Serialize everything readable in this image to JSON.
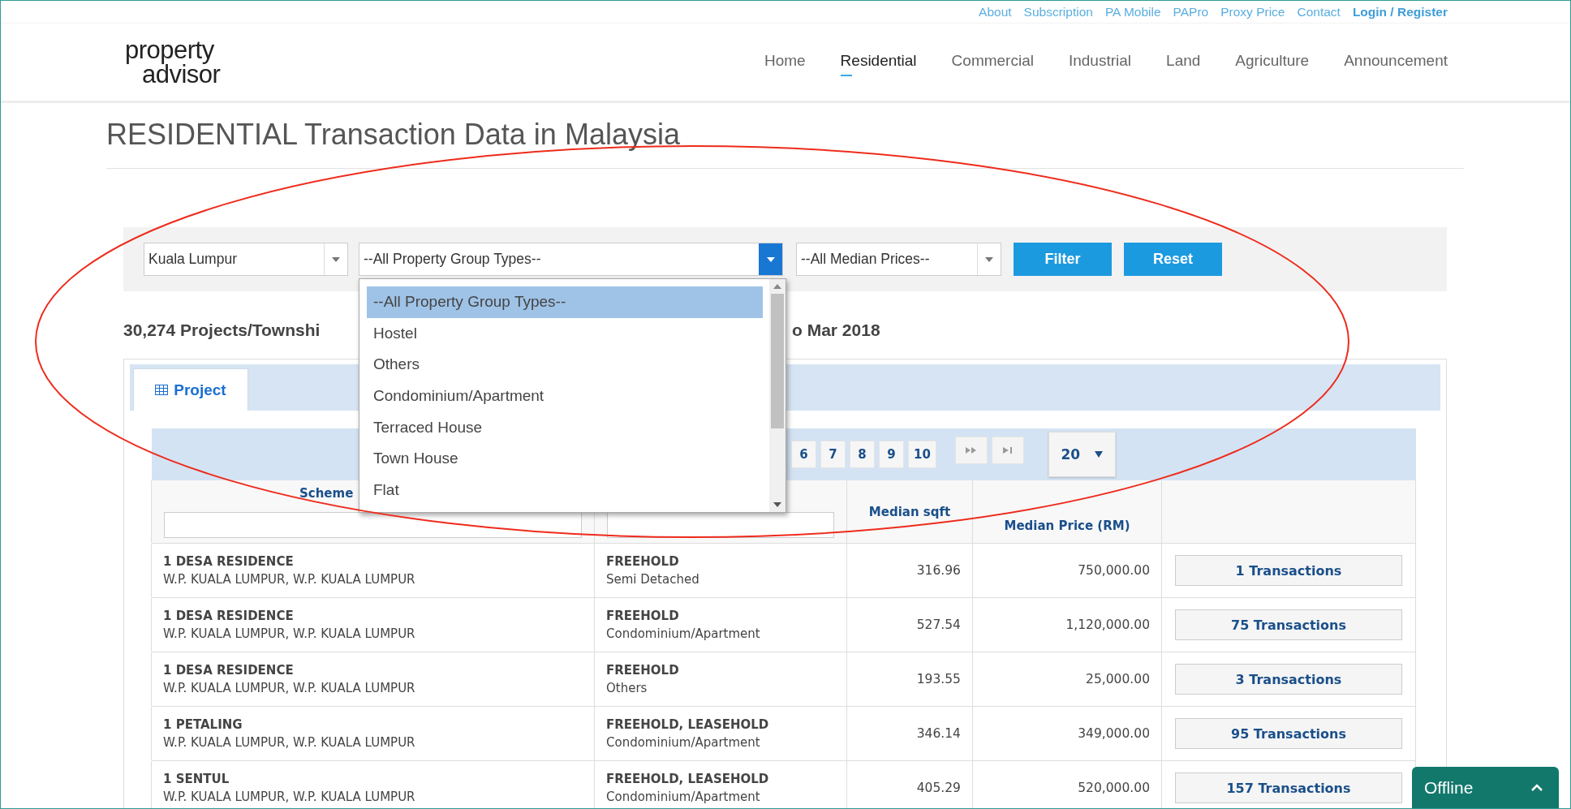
{
  "top_links": [
    {
      "label": "About",
      "kind": "link"
    },
    {
      "label": "Subscription",
      "kind": "link"
    },
    {
      "label": "PA Mobile",
      "kind": "link"
    },
    {
      "label": "PAPro",
      "kind": "link"
    },
    {
      "label": "Proxy Price",
      "kind": "link"
    },
    {
      "label": "Contact",
      "kind": "link"
    },
    {
      "label": "Login / Register",
      "kind": "account"
    }
  ],
  "logo": {
    "line1": "property",
    "line2": "advisor"
  },
  "nav": [
    {
      "label": "Home",
      "selected": false
    },
    {
      "label": "Residential",
      "selected": true
    },
    {
      "label": "Commercial",
      "selected": false
    },
    {
      "label": "Industrial",
      "selected": false
    },
    {
      "label": "Land",
      "selected": false
    },
    {
      "label": "Agriculture",
      "selected": false
    },
    {
      "label": "Announcement",
      "selected": false
    }
  ],
  "title": "RESIDENTIAL Transaction Data in Malaysia",
  "filters": {
    "state": "Kuala Lumpur",
    "group_type": {
      "value": "--All Property Group Types--",
      "open": true
    },
    "median_price": "--All Median Prices--"
  },
  "buttons": [
    "Filter",
    "Reset"
  ],
  "dropdown_options": [
    {
      "label": "--All Property Group Types--",
      "selected": true
    },
    {
      "label": "Hostel",
      "selected": false
    },
    {
      "label": "Others",
      "selected": false
    },
    {
      "label": "Condominium/Apartment",
      "selected": false
    },
    {
      "label": "Terraced House",
      "selected": false
    },
    {
      "label": "Town House",
      "selected": false
    },
    {
      "label": "Flat",
      "selected": false
    }
  ],
  "summary": [
    "30,274 Projects/Townshi",
    "o Mar 2018"
  ],
  "tabs": [
    {
      "label": "Project",
      "selected": true
    }
  ],
  "pager": {
    "pages": [
      "6",
      "7",
      "8",
      "9",
      "10"
    ],
    "page_size": "20"
  },
  "columns": [
    {
      "label": "Scheme",
      "filter": true
    },
    {
      "filter": true
    },
    {
      "label": "Median sqft"
    },
    {
      "label": "Median Price (RM)"
    }
  ],
  "rows": [
    {
      "name": "1 DESA RESIDENCE",
      "location": "W.P. KUALA LUMPUR, W.P. KUALA LUMPUR",
      "tenure": "FREEHOLD",
      "type": "Semi Detached",
      "sqft": "316.96",
      "price": "750,000.00",
      "action": "1 Transactions"
    },
    {
      "name": "1 DESA RESIDENCE",
      "location": "W.P. KUALA LUMPUR, W.P. KUALA LUMPUR",
      "tenure": "FREEHOLD",
      "type": "Condominium/Apartment",
      "sqft": "527.54",
      "price": "1,120,000.00",
      "action": "75 Transactions"
    },
    {
      "name": "1 DESA RESIDENCE",
      "location": "W.P. KUALA LUMPUR, W.P. KUALA LUMPUR",
      "tenure": "FREEHOLD",
      "type": "Others",
      "sqft": "193.55",
      "price": "25,000.00",
      "action": "3 Transactions"
    },
    {
      "name": "1 PETALING",
      "location": "W.P. KUALA LUMPUR, W.P. KUALA LUMPUR",
      "tenure": "FREEHOLD, LEASEHOLD",
      "type": "Condominium/Apartment",
      "sqft": "346.14",
      "price": "349,000.00",
      "action": "95 Transactions"
    },
    {
      "name": "1 SENTUL",
      "location": "W.P. KUALA LUMPUR, W.P. KUALA LUMPUR",
      "tenure": "FREEHOLD, LEASEHOLD",
      "type": "Condominium/Apartment",
      "sqft": "405.29",
      "price": "520,000.00",
      "action": "157 Transactions"
    }
  ],
  "chat": {
    "label": "Offline"
  }
}
